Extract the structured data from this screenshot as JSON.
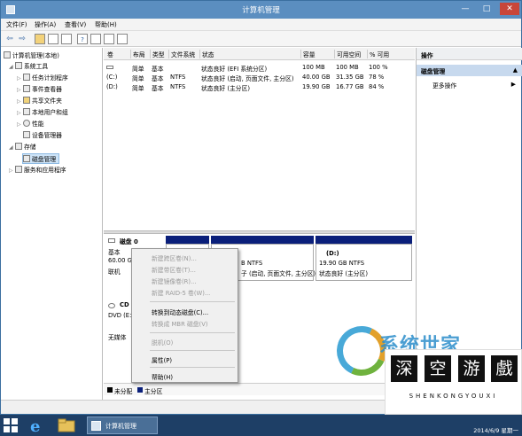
{
  "window": {
    "title": "计算机管理",
    "menus": [
      "文件(F)",
      "操作(A)",
      "查看(V)",
      "帮助(H)"
    ],
    "controls": {
      "minimize": "—",
      "maximize": "□",
      "close": "✕"
    }
  },
  "toolbar": {
    "back": "⇦",
    "forward": "⇨",
    "icons": [
      "up-folder-icon",
      "console-tree-icon",
      "properties-icon",
      "help-icon",
      "details-icon",
      "export-icon",
      "refresh-icon"
    ]
  },
  "tree": {
    "root": "计算机管理(本地)",
    "system_tools": "系统工具",
    "items": [
      "任务计划程序",
      "事件查看器",
      "共享文件夹",
      "本地用户和组",
      "性能",
      "设备管理器"
    ],
    "storage": "存储",
    "disk_management": "磁盘管理",
    "services": "服务和应用程序"
  },
  "volumes": {
    "headers": [
      "卷",
      "布局",
      "类型",
      "文件系统",
      "状态",
      "容量",
      "可用空间",
      "% 可用"
    ],
    "rows": [
      [
        "",
        "简单",
        "基本",
        "",
        "状态良好 (EFI 系统分区)",
        "100 MB",
        "100 MB",
        "100 %"
      ],
      [
        "(C:)",
        "简单",
        "基本",
        "NTFS",
        "状态良好 (启动, 页面文件, 主分区)",
        "40.00 GB",
        "31.35 GB",
        "78 %"
      ],
      [
        "(D:)",
        "简单",
        "基本",
        "NTFS",
        "状态良好 (主分区)",
        "19.90 GB",
        "16.77 GB",
        "84 %"
      ]
    ]
  },
  "disk0": {
    "title": "磁盘 0",
    "type": "基本",
    "size": "60.00 G",
    "state": "联机",
    "part_c": [
      "B NTFS",
      "子 (启动, 页面文件, 主分区)"
    ],
    "part_d": [
      "(D:)",
      "19.90 GB NTFS",
      "状态良好 (主分区)"
    ]
  },
  "cdrom": {
    "title": "CD",
    "name": "DVD (E:",
    "state": "无媒体"
  },
  "legend": {
    "unallocated": "未分配",
    "primary": "主分区",
    "unallocated_color": "#000000",
    "primary_color": "#0a1f7a"
  },
  "context_menu": {
    "items": [
      {
        "label": "新建跨区卷(N)...",
        "enabled": false
      },
      {
        "label": "新建带区卷(T)...",
        "enabled": false
      },
      {
        "label": "新建镜像卷(R)...",
        "enabled": false
      },
      {
        "label": "新建 RAID-5 卷(W)...",
        "enabled": false
      },
      {
        "label": "转换到动态磁盘(C)...",
        "enabled": true
      },
      {
        "label": "转换成 MBR 磁盘(V)",
        "enabled": false
      },
      {
        "label": "脱机(O)",
        "enabled": false
      },
      {
        "label": "属性(P)",
        "enabled": true
      },
      {
        "label": "帮助(H)",
        "enabled": true
      }
    ]
  },
  "actions": {
    "header": "操作",
    "section": "磁盘管理",
    "more": "更多操作"
  },
  "taskbar": {
    "task_label": "计算机管理",
    "date": "2014/6/9 星期一"
  },
  "watermark": {
    "logo_text": "系统世家",
    "chars": [
      "深",
      "空",
      "游",
      "戲"
    ],
    "subtitle": "SHENKONGYOUXI"
  },
  "colors": {
    "titlebar": "#5b8ec0",
    "taskbar": "#1e3f66",
    "selection": "#cde3f7",
    "primary_partition": "#0a1f7a"
  }
}
